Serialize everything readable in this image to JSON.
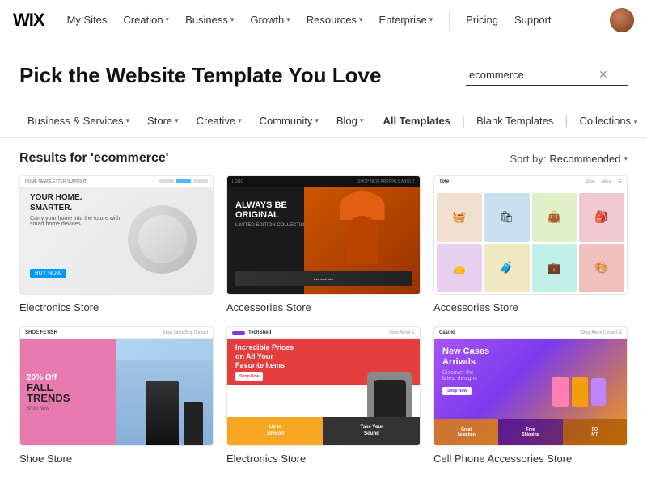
{
  "header": {
    "logo": "WIX",
    "nav": [
      {
        "label": "My Sites",
        "hasDropdown": false
      },
      {
        "label": "Creation",
        "hasDropdown": true
      },
      {
        "label": "Business",
        "hasDropdown": true
      },
      {
        "label": "Growth",
        "hasDropdown": true
      },
      {
        "label": "Resources",
        "hasDropdown": true
      },
      {
        "label": "Enterprise",
        "hasDropdown": true
      }
    ],
    "pricing": "Pricing",
    "support": "Support"
  },
  "hero": {
    "title": "Pick the Website Template You Love",
    "search_value": "ecommerce",
    "search_placeholder": "ecommerce"
  },
  "filter_nav": {
    "left": [
      {
        "label": "Business & Services",
        "hasDropdown": true
      },
      {
        "label": "Store",
        "hasDropdown": true
      },
      {
        "label": "Creative",
        "hasDropdown": true
      },
      {
        "label": "Community",
        "hasDropdown": true
      },
      {
        "label": "Blog",
        "hasDropdown": true
      }
    ],
    "right": [
      {
        "label": "All Templates",
        "active": true
      },
      {
        "label": "Blank Templates",
        "active": false
      },
      {
        "label": "Collections",
        "hasDropdown": true,
        "active": false
      }
    ]
  },
  "results": {
    "title": "Results for 'ecommerce'",
    "sort_label": "Sort by:",
    "sort_value": "Recommended",
    "templates": [
      {
        "name": "Electronics Store",
        "id": "electronics1"
      },
      {
        "name": "Accessories Store",
        "id": "accessories1"
      },
      {
        "name": "Accessories Store",
        "id": "tote"
      },
      {
        "name": "Shoe Store",
        "id": "shoe"
      },
      {
        "name": "Electronics Store",
        "id": "techshed"
      },
      {
        "name": "Cell Phone Accessories Store",
        "id": "cellphone"
      }
    ]
  }
}
